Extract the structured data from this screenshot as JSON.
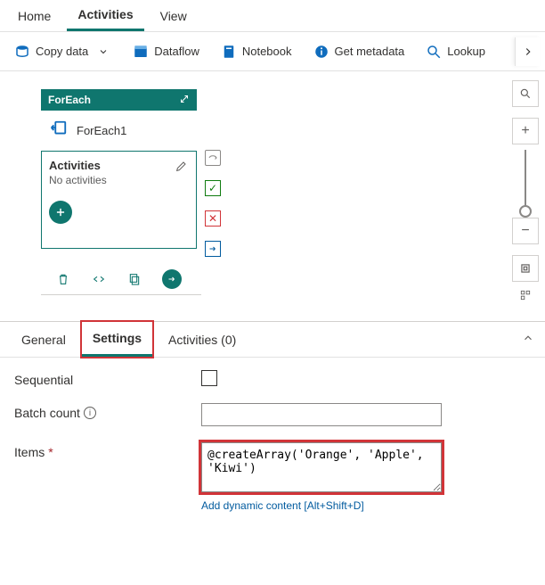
{
  "top_tabs": {
    "home": "Home",
    "activities": "Activities",
    "view": "View"
  },
  "toolbar": {
    "copy_data": "Copy data",
    "dataflow": "Dataflow",
    "notebook": "Notebook",
    "get_metadata": "Get metadata",
    "lookup": "Lookup"
  },
  "activity": {
    "type": "ForEach",
    "name": "ForEach1",
    "body_title": "Activities",
    "body_subtitle": "No activities"
  },
  "panel_tabs": {
    "general": "General",
    "settings": "Settings",
    "activities": "Activities (0)"
  },
  "settings": {
    "sequential_label": "Sequential",
    "batch_count_label": "Batch count",
    "batch_count_value": "",
    "items_label": "Items",
    "items_value": "@createArray('Orange', 'Apple', 'Kiwi')",
    "dynamic_link": "Add dynamic content [Alt+Shift+D]"
  }
}
